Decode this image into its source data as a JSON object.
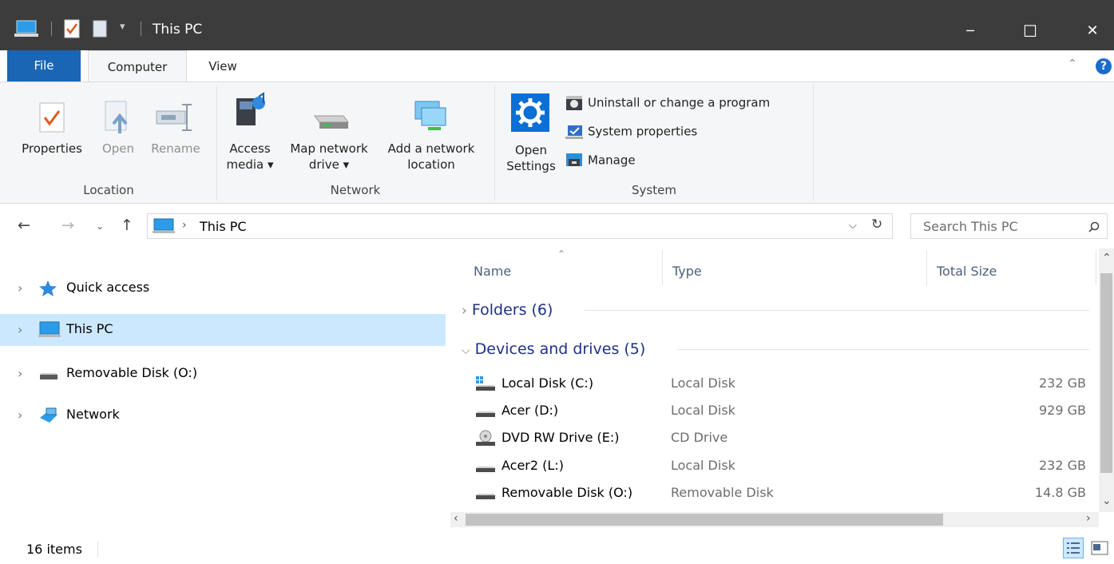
{
  "window": {
    "title": "This PC",
    "minimize_glyph": "─",
    "maximize_glyph": "☐",
    "close_glyph": "✕"
  },
  "tabs": {
    "file": "File",
    "computer": "Computer",
    "view": "View"
  },
  "ribbon": {
    "location": {
      "label": "Location",
      "properties": "Properties",
      "open": "Open",
      "rename": "Rename"
    },
    "network": {
      "label": "Network",
      "access_media_l1": "Access",
      "access_media_l2": "media ▾",
      "map_drive_l1": "Map network",
      "map_drive_l2": "drive ▾",
      "add_location_l1": "Add a network",
      "add_location_l2": "location"
    },
    "system": {
      "label": "System",
      "open_settings_l1": "Open",
      "open_settings_l2": "Settings",
      "uninstall": "Uninstall or change a program",
      "system_properties": "System properties",
      "manage": "Manage"
    }
  },
  "address": {
    "path": "This PC",
    "search_placeholder": "Search This PC"
  },
  "nav_pane": {
    "items": [
      {
        "label": "Quick access",
        "icon": "star-icon"
      },
      {
        "label": "This PC",
        "icon": "computer-icon",
        "selected": true
      },
      {
        "label": "Removable Disk (O:)",
        "icon": "drive-icon"
      },
      {
        "label": "Network",
        "icon": "network-icon"
      }
    ]
  },
  "content": {
    "columns": {
      "name": "Name",
      "type": "Type",
      "total_size": "Total Size"
    },
    "groups": {
      "folders": "Folders (6)",
      "devices": "Devices and drives (5)"
    },
    "drives": [
      {
        "name": "Local Disk (C:)",
        "type": "Local Disk",
        "size": "232 GB"
      },
      {
        "name": "Acer (D:)",
        "type": "Local Disk",
        "size": "929 GB"
      },
      {
        "name": "DVD RW Drive (E:)",
        "type": "CD Drive",
        "size": ""
      },
      {
        "name": "Acer2 (L:)",
        "type": "Local Disk",
        "size": "232 GB"
      },
      {
        "name": "Removable Disk (O:)",
        "type": "Removable Disk",
        "size": "14.8 GB"
      }
    ]
  },
  "status": {
    "item_count": "16 items"
  },
  "colors": {
    "accent": "#1a66b4",
    "selection": "#cce8ff",
    "titlebar": "#3c3c3c"
  }
}
